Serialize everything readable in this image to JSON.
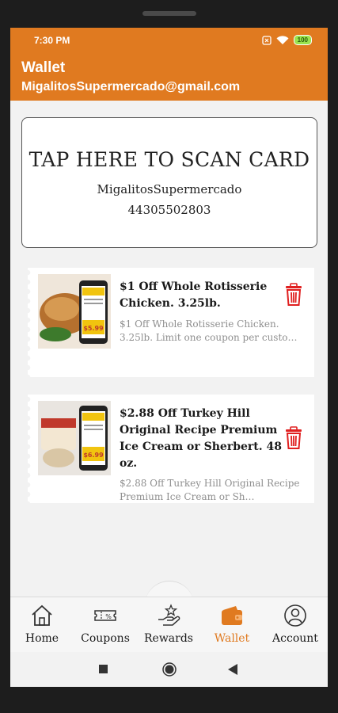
{
  "status": {
    "time": "7:30 PM",
    "battery": "100"
  },
  "header": {
    "title": "Wallet",
    "email": "MigalitosSupermercado@gmail.com"
  },
  "scan_card": {
    "cta": "TAP HERE TO SCAN CARD",
    "store": "MigalitosSupermercado",
    "number": "44305502803"
  },
  "coupons": [
    {
      "title": "$1 Off Whole Rotisserie Chicken. 3.25lb.",
      "description": "$1 Off Whole Rotisserie Chicken. 3.25lb. Limit one coupon per custo…",
      "thumb_price": "$5.99"
    },
    {
      "title": "$2.88 Off Turkey Hill Original Recipe Premium Ice Cream or Sherbert. 48 oz.",
      "description": "$2.88 Off Turkey Hill Original Recipe Premium Ice Cream or Sh…",
      "thumb_price": "$6.99"
    }
  ],
  "nav": {
    "items": [
      {
        "label": "Home",
        "icon": "home-icon"
      },
      {
        "label": "Coupons",
        "icon": "coupon-icon"
      },
      {
        "label": "Rewards",
        "icon": "rewards-icon"
      },
      {
        "label": "Wallet",
        "icon": "wallet-icon"
      },
      {
        "label": "Account",
        "icon": "account-icon"
      }
    ],
    "active": "Wallet"
  },
  "colors": {
    "brand": "#e07a20",
    "trash": "#e02020",
    "battery": "#9be34e"
  }
}
